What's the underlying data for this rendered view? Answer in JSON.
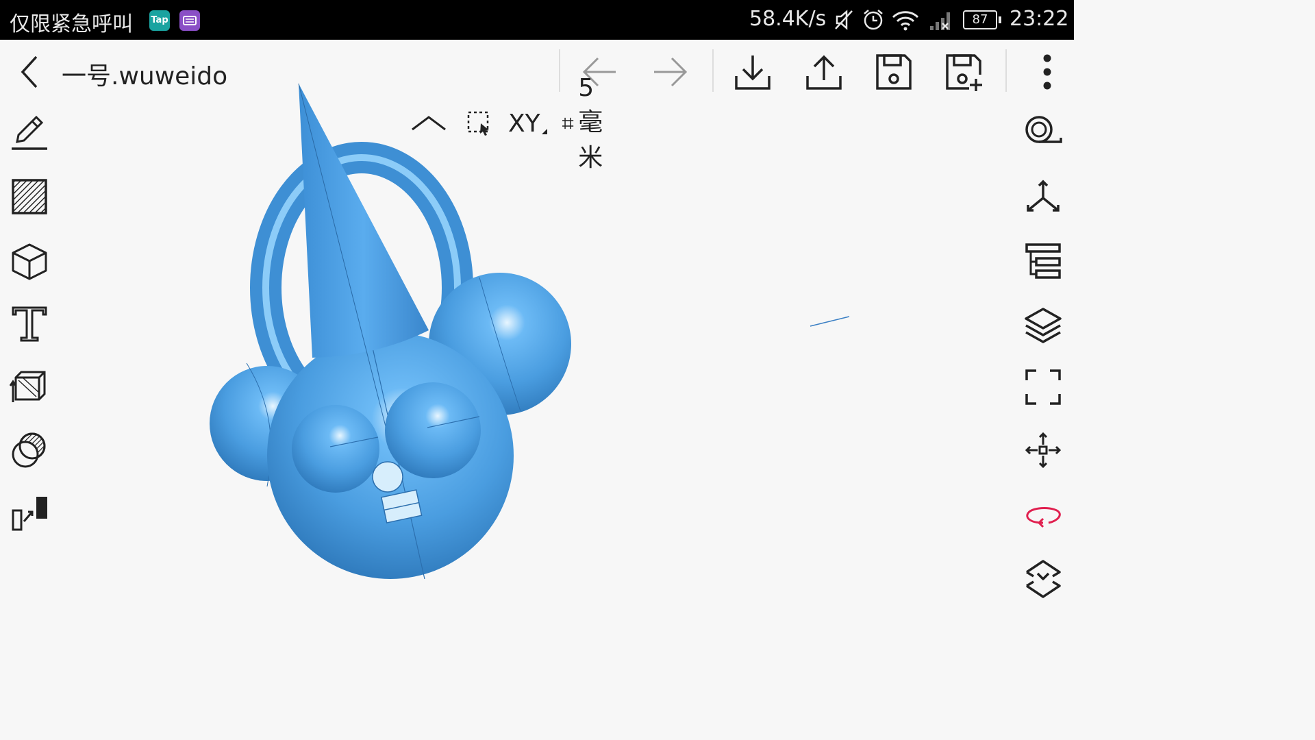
{
  "status_bar": {
    "emergency_text": "仅限紧急呼叫",
    "app_badge_1": "Tap",
    "network_speed": "58.4K/s",
    "battery_level": "87",
    "time": "23:22"
  },
  "toolbar": {
    "back_icon": "chevron-left-icon",
    "file_title": "一号.wuweido",
    "undo_icon": "arrow-left-icon",
    "redo_icon": "arrow-right-icon",
    "import_icon": "download-icon",
    "export_icon": "upload-icon",
    "save_icon": "save-icon",
    "save_as_icon": "save-add-icon",
    "more_icon": "more-vertical-icon"
  },
  "view_options": {
    "collapse_icon": "chevron-up-icon",
    "select_icon": "dashed-select-icon",
    "plane_label": "XY",
    "grid_label": "5 毫米"
  },
  "left_tools": [
    {
      "name": "sketch-pencil-icon"
    },
    {
      "name": "hatch-surface-icon"
    },
    {
      "name": "cube-icon"
    },
    {
      "name": "text-icon"
    },
    {
      "name": "extrude-box-icon"
    },
    {
      "name": "boolean-circles-icon"
    },
    {
      "name": "scale-transform-icon"
    }
  ],
  "right_tools": [
    {
      "name": "zoom-tape-icon"
    },
    {
      "name": "axes-icon"
    },
    {
      "name": "tree-icon"
    },
    {
      "name": "layers-icon"
    },
    {
      "name": "fullscreen-icon"
    },
    {
      "name": "move-icon"
    },
    {
      "name": "rotate-icon"
    },
    {
      "name": "snap-icon"
    }
  ],
  "colors": {
    "model_blue": "#4a9de0",
    "rotate_accent": "#e0204f",
    "status_bg": "#000000",
    "canvas_bg": "#f7f7f7"
  }
}
